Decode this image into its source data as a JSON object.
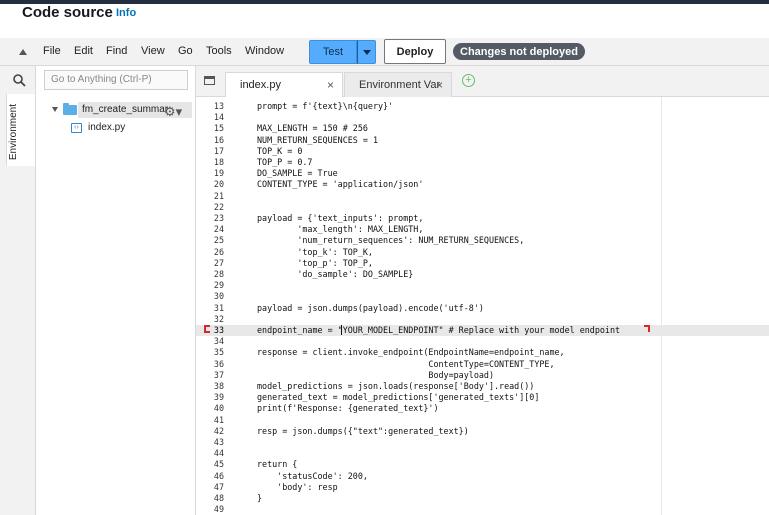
{
  "header": {
    "title": "Code source",
    "info_link": "Info"
  },
  "menu": {
    "items": [
      "File",
      "Edit",
      "Find",
      "View",
      "Go",
      "Tools",
      "Window"
    ]
  },
  "actions": {
    "test_label": "Test",
    "deploy_label": "Deploy",
    "status_badge": "Changes not deployed"
  },
  "rail": {
    "environment_label": "Environment"
  },
  "sidebar": {
    "goto_placeholder": "Go to Anything (Ctrl-P)",
    "folder_name": "fm_create_summar",
    "file_name": "index.py"
  },
  "tabs": [
    {
      "label": "index.py",
      "close": "×"
    },
    {
      "label": "Environment Var",
      "close": "×"
    }
  ],
  "tab_add": "+",
  "colors": {
    "accent": "#55acff",
    "highlight_bracket": "#d9262a",
    "badge": "#545b64"
  },
  "editor": {
    "active_line": 33,
    "lines": [
      {
        "n": "13",
        "text": "    prompt = f'{text}\\n{query}'"
      },
      {
        "n": "14",
        "text": ""
      },
      {
        "n": "15",
        "text": "    MAX_LENGTH = 150 # 256"
      },
      {
        "n": "16",
        "text": "    NUM_RETURN_SEQUENCES = 1"
      },
      {
        "n": "17",
        "text": "    TOP_K = 0"
      },
      {
        "n": "18",
        "text": "    TOP_P = 0.7"
      },
      {
        "n": "19",
        "text": "    DO_SAMPLE = True"
      },
      {
        "n": "20",
        "text": "    CONTENT_TYPE = 'application/json'"
      },
      {
        "n": "21",
        "text": ""
      },
      {
        "n": "22",
        "text": ""
      },
      {
        "n": "23",
        "text": "    payload = {'text_inputs': prompt,"
      },
      {
        "n": "24",
        "text": "            'max_length': MAX_LENGTH,"
      },
      {
        "n": "25",
        "text": "            'num_return_sequences': NUM_RETURN_SEQUENCES,"
      },
      {
        "n": "26",
        "text": "            'top_k': TOP_K,"
      },
      {
        "n": "27",
        "text": "            'top_p': TOP_P,"
      },
      {
        "n": "28",
        "text": "            'do_sample': DO_SAMPLE}"
      },
      {
        "n": "29",
        "text": ""
      },
      {
        "n": "30",
        "text": ""
      },
      {
        "n": "31",
        "text": "    payload = json.dumps(payload).encode('utf-8')"
      },
      {
        "n": "32",
        "text": ""
      },
      {
        "n": "33",
        "text": "    endpoint_name = \"YOUR_MODEL_ENDPOINT\" # Replace with your model endpoint"
      },
      {
        "n": "34",
        "text": ""
      },
      {
        "n": "35",
        "text": "    response = client.invoke_endpoint(EndpointName=endpoint_name,"
      },
      {
        "n": "36",
        "text": "                                      ContentType=CONTENT_TYPE,"
      },
      {
        "n": "37",
        "text": "                                      Body=payload)"
      },
      {
        "n": "38",
        "text": "    model_predictions = json.loads(response['Body'].read())"
      },
      {
        "n": "39",
        "text": "    generated_text = model_predictions['generated_texts'][0]"
      },
      {
        "n": "40",
        "text": "    print(f'Response: {generated_text}')"
      },
      {
        "n": "41",
        "text": ""
      },
      {
        "n": "42",
        "text": "    resp = json.dumps({\"text\":generated_text})"
      },
      {
        "n": "43",
        "text": ""
      },
      {
        "n": "44",
        "text": ""
      },
      {
        "n": "45",
        "text": "    return {"
      },
      {
        "n": "46",
        "text": "        'statusCode': 200,"
      },
      {
        "n": "47",
        "text": "        'body': resp"
      },
      {
        "n": "48",
        "text": "    }"
      },
      {
        "n": "49",
        "text": ""
      }
    ]
  }
}
